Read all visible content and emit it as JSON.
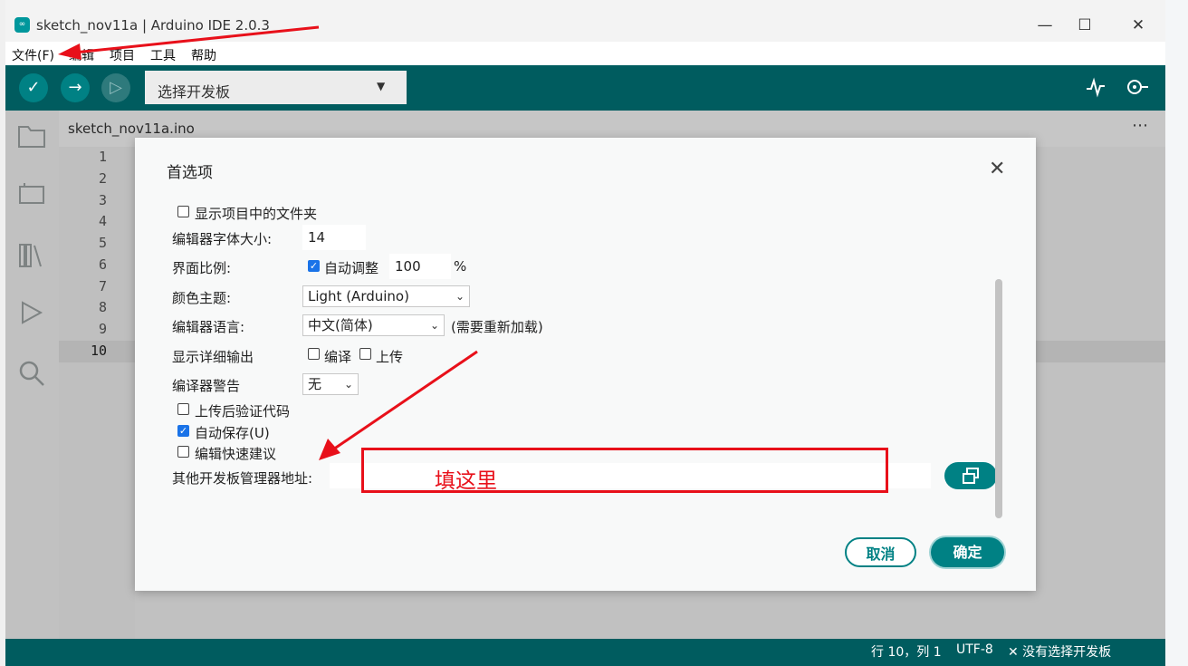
{
  "window": {
    "title": "sketch_nov11a | Arduino IDE 2.0.3",
    "icon_text": "∞",
    "minimize": "—",
    "maximize": "☐",
    "close": "✕"
  },
  "menubar": {
    "items": [
      "文件(F)",
      "编辑",
      "项目",
      "工具",
      "帮助"
    ]
  },
  "toolbar": {
    "board_select": "选择开发板",
    "icons": [
      "verify-icon",
      "upload-icon",
      "debug-icon",
      "serial-plotter-icon",
      "serial-monitor-icon"
    ]
  },
  "editor": {
    "tab": "sketch_nov11a.ino",
    "tab_more": "⋯",
    "line_numbers": [
      "1",
      "2",
      "3",
      "4",
      "5",
      "6",
      "7",
      "8",
      "9",
      "10"
    ]
  },
  "status_bar": {
    "position": "行 10，列 1",
    "encoding": "UTF-8",
    "board": "✕ 没有选择开发板"
  },
  "dialog": {
    "title": "首选项",
    "show_sketch_files": "显示项目中的文件夹",
    "font_size_label": "编辑器字体大小:",
    "font_size_value": "14",
    "scale_label": "界面比例:",
    "scale_auto_label": "自动调整",
    "scale_value": "100",
    "scale_unit": "%",
    "theme_label": "颜色主题:",
    "theme_value": "Light (Arduino)",
    "language_label": "编辑器语言:",
    "language_value": "中文(简体)",
    "language_note": "(需要重新加载)",
    "verbose_label": "显示详细输出",
    "verbose_compile": "编译",
    "verbose_upload": "上传",
    "warnings_label": "编译器警告",
    "warnings_value": "无",
    "verify_after_upload": "上传后验证代码",
    "auto_save": "自动保存(U)",
    "quick_suggestions": "编辑快速建议",
    "board_urls_label": "其他开发板管理器地址:",
    "board_urls_value": "",
    "cancel": "取消",
    "ok": "确定",
    "checked": {
      "show_sketch_files": false,
      "scale_auto": true,
      "verbose_compile": false,
      "verbose_upload": false,
      "verify_after_upload": false,
      "auto_save": true,
      "quick_suggestions": false
    }
  },
  "annotation": {
    "text": "填这里",
    "color": "#e8101a"
  },
  "colors": {
    "accent": "#008184",
    "toolbar": "#005c5f"
  }
}
